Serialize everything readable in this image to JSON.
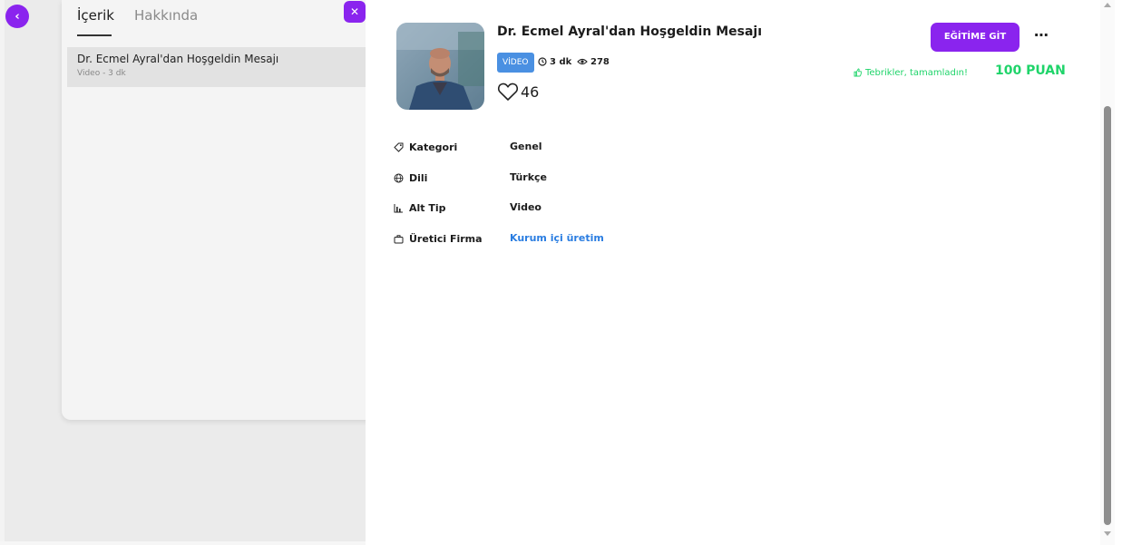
{
  "background_page": {
    "tabs": [
      {
        "label": "İçerik",
        "active": true
      },
      {
        "label": "Hakkında",
        "active": false
      }
    ],
    "list_item": {
      "title": "Dr. Ecmel Ayral'dan Hoşgeldin Mesajı",
      "meta": "Video - 3 dk"
    },
    "back_icon": "chevron-left-icon",
    "close_icon": "close-icon"
  },
  "detail": {
    "title": "Dr. Ecmel Ayral'dan Hoşgeldin Mesajı",
    "badge": "VİDEO",
    "duration": "3 dk",
    "views": "278",
    "likes": "46",
    "cta_label": "EĞİTİME GİT",
    "more_label": "⋯",
    "congrats_text": "Tebrikler, tamamladın!",
    "points": "100 PUAN",
    "info": [
      {
        "icon": "tag-icon",
        "label": "Kategori",
        "value": "Genel",
        "link": false
      },
      {
        "icon": "globe-icon",
        "label": "Dili",
        "value": "Türkçe",
        "link": false
      },
      {
        "icon": "bar-chart-icon",
        "label": "Alt Tip",
        "value": "Video",
        "link": false
      },
      {
        "icon": "briefcase-icon",
        "label": "Üretici Firma",
        "value": "Kurum içi üretim",
        "link": true
      }
    ]
  },
  "colors": {
    "accent": "#8a24ee",
    "success": "#1fd46a",
    "badge": "#4a90e2",
    "link": "#2a7de1"
  }
}
